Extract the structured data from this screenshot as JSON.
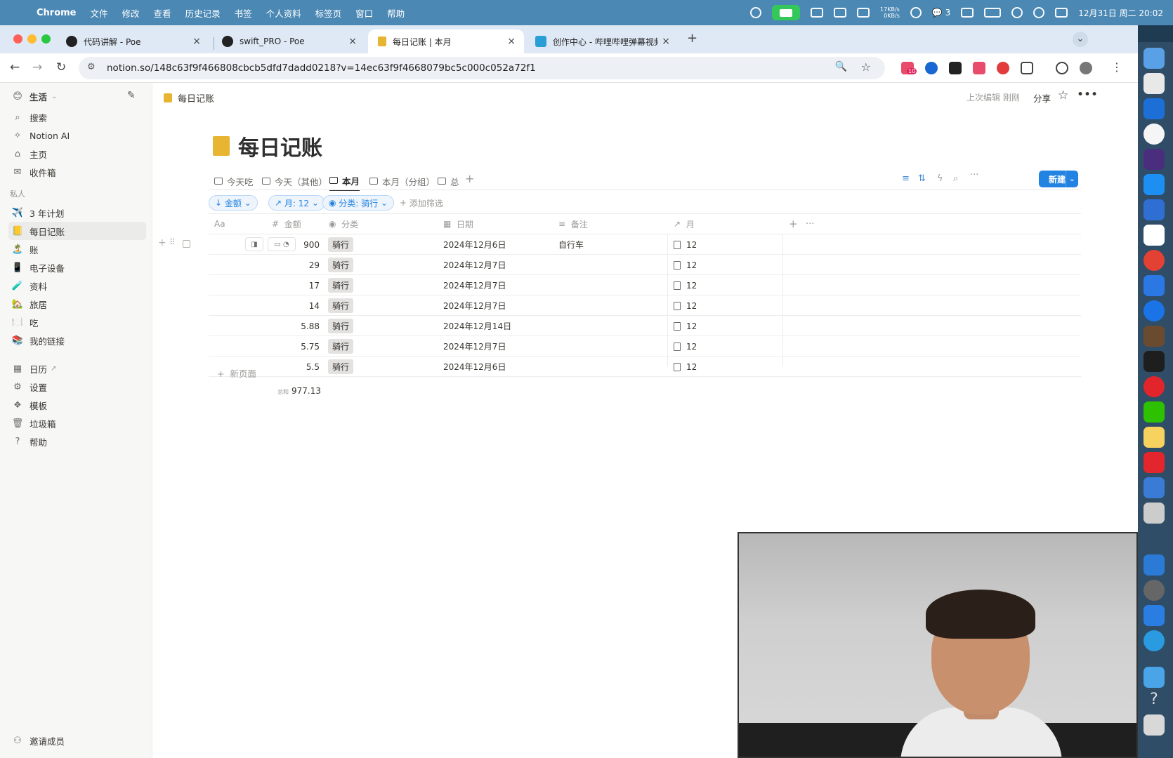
{
  "menubar": {
    "items": [
      "Chrome",
      "文件",
      "修改",
      "查看",
      "历史记录",
      "书签",
      "个人资料",
      "标签页",
      "窗口",
      "帮助"
    ],
    "wechat_count": "3",
    "net_up": "17KB/s",
    "net_down": "0KB/s",
    "datetime": "12月31日 周二  20:02"
  },
  "tabs": [
    {
      "title": "代码讲解 - Poe"
    },
    {
      "title": "swift_PRO - Poe"
    },
    {
      "title": "每日记账 | 本月"
    },
    {
      "title": "创作中心 - 哔哩哔哩弹幕视频网"
    }
  ],
  "address": {
    "url": "notion.so/148c63f9f466808cbcb5dfd7dadd0218?v=14ec63f9f4668079bc5c000c052a72f1",
    "ext_badge": "10"
  },
  "sidebar": {
    "workspace": "生活",
    "top": [
      {
        "label": "搜索",
        "icon": "search-icon"
      },
      {
        "label": "Notion AI",
        "icon": "notion-ai-icon"
      },
      {
        "label": "主页",
        "icon": "home-icon"
      },
      {
        "label": "收件箱",
        "icon": "inbox-icon"
      }
    ],
    "section": "私人",
    "pages": [
      {
        "label": "3 年计划",
        "icon": "✈️"
      },
      {
        "label": "每日记账",
        "icon": "📒"
      },
      {
        "label": "账",
        "icon": "🏝️"
      },
      {
        "label": "电子设备",
        "icon": "📱"
      },
      {
        "label": "资料",
        "icon": "🧪"
      },
      {
        "label": "旅居",
        "icon": "🏡"
      },
      {
        "label": "吃",
        "icon": "🍽️"
      },
      {
        "label": "我的链接",
        "icon": "📚"
      }
    ],
    "bottom": [
      {
        "label": "日历",
        "icon": "calendar-icon"
      },
      {
        "label": "设置",
        "icon": "gear-icon"
      },
      {
        "label": "模板",
        "icon": "template-icon"
      },
      {
        "label": "垃圾箱",
        "icon": "trash-icon"
      },
      {
        "label": "帮助",
        "icon": "help-icon"
      }
    ],
    "invite": "邀请成员"
  },
  "topbar": {
    "breadcrumb": "每日记账",
    "edited": "上次编辑 刚刚",
    "share": "分享"
  },
  "page": {
    "title": "每日记账",
    "views": [
      "今天吃",
      "今天（其他）",
      "本月",
      "本月（分组）",
      "总"
    ],
    "active_view": "本月",
    "new_button": "新建",
    "filters": [
      "金额",
      "月: 12",
      "分类: 骑行"
    ],
    "add_filter": "添加筛选"
  },
  "table": {
    "columns": [
      {
        "label": "Aa",
        "icon": ""
      },
      {
        "label": "金额",
        "icon": "#"
      },
      {
        "label": "分类",
        "icon": "select-icon"
      },
      {
        "label": "日期",
        "icon": "calendar-icon"
      },
      {
        "label": "备注",
        "icon": "text-icon"
      },
      {
        "label": "月",
        "icon": "relation-icon"
      }
    ],
    "rows": [
      {
        "amount": "900",
        "category": "骑行",
        "date": "2024年12月6日",
        "note": "自行车",
        "month": "12"
      },
      {
        "amount": "29",
        "category": "骑行",
        "date": "2024年12月7日",
        "note": "",
        "month": "12"
      },
      {
        "amount": "17",
        "category": "骑行",
        "date": "2024年12月7日",
        "note": "",
        "month": "12"
      },
      {
        "amount": "14",
        "category": "骑行",
        "date": "2024年12月7日",
        "note": "",
        "month": "12"
      },
      {
        "amount": "5.88",
        "category": "骑行",
        "date": "2024年12月14日",
        "note": "",
        "month": "12"
      },
      {
        "amount": "5.75",
        "category": "骑行",
        "date": "2024年12月7日",
        "note": "",
        "month": "12"
      },
      {
        "amount": "5.5",
        "category": "骑行",
        "date": "2024年12月6日",
        "note": "",
        "month": "12"
      }
    ],
    "new_page": "新页面",
    "sum_label": "总和",
    "sum_value": "977.13"
  },
  "colors": {
    "accent": "#2383e2",
    "menubar": "#4b88b4"
  }
}
